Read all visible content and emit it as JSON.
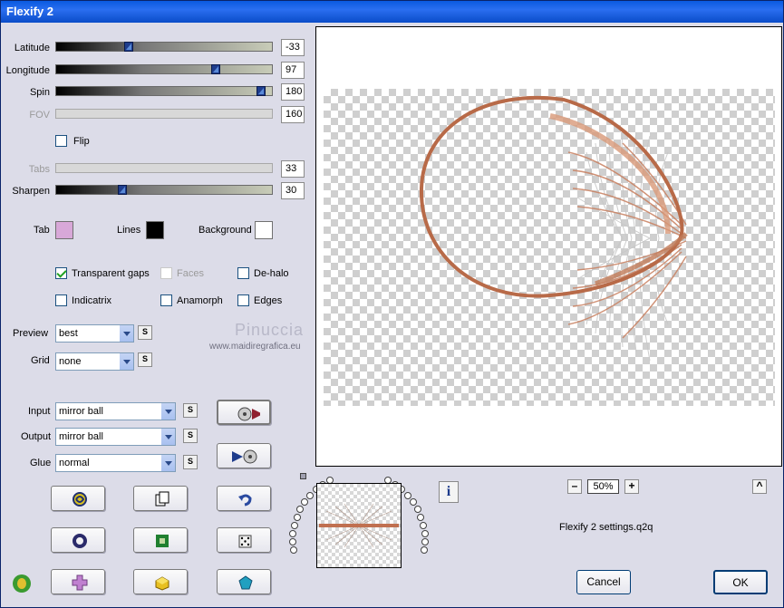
{
  "window": {
    "title": "Flexify 2"
  },
  "sliders": [
    {
      "label": "Latitude",
      "value": "-33",
      "level": 0.33,
      "enabled": true
    },
    {
      "label": "Longitude",
      "value": "97",
      "level": 0.75,
      "enabled": true
    },
    {
      "label": "Spin",
      "value": "180",
      "level": 0.97,
      "enabled": true
    },
    {
      "label": "FOV",
      "value": "160",
      "level": 0,
      "enabled": false
    },
    {
      "label": "Tabs",
      "value": "33",
      "level": 0,
      "enabled": false
    },
    {
      "label": "Sharpen",
      "value": "30",
      "level": 0.3,
      "enabled": true
    }
  ],
  "flip": {
    "label": "Flip",
    "checked": false
  },
  "colors": {
    "tab": {
      "label": "Tab",
      "color": "#d8a8d8"
    },
    "lines": {
      "label": "Lines",
      "color": "#000000"
    },
    "background": {
      "label": "Background",
      "color": "#ffffff"
    }
  },
  "options": {
    "transparent_gaps": {
      "label": "Transparent gaps",
      "checked": true
    },
    "faces": {
      "label": "Faces",
      "checked": false
    },
    "de_halo": {
      "label": "De-halo",
      "checked": false
    },
    "indicatrix": {
      "label": "Indicatrix",
      "checked": false
    },
    "anamorph": {
      "label": "Anamorph",
      "checked": false
    },
    "edges": {
      "label": "Edges",
      "checked": false
    }
  },
  "preview": {
    "label": "Preview",
    "value": "best"
  },
  "grid": {
    "label": "Grid",
    "value": "none"
  },
  "input": {
    "label": "Input",
    "value": "mirror ball"
  },
  "output": {
    "label": "Output",
    "value": "mirror ball"
  },
  "glue": {
    "label": "Glue",
    "value": "normal"
  },
  "s_button": "S",
  "watermark": {
    "line1": "Pinuccia",
    "line2": "www.maidiregrafica.eu"
  },
  "zoom": {
    "value": "50%",
    "minus": "–",
    "plus": "+"
  },
  "settings_file": "Flexify 2 settings.q2q",
  "buttons": {
    "cancel": "Cancel",
    "ok": "OK",
    "collapse": "^"
  },
  "info_icon": "i"
}
